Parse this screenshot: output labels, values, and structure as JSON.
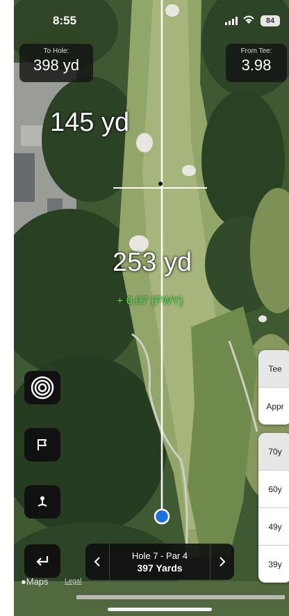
{
  "status": {
    "time": "8:55",
    "battery": "84"
  },
  "to_hole": {
    "label": "To Hole:",
    "value": "398 yd"
  },
  "from_tee": {
    "label": "From Tee:",
    "value": "3.98"
  },
  "distances": {
    "upper": "145 yd",
    "lower": "253 yd",
    "delta": "+ 0.07 (FWY)"
  },
  "buttons": {
    "target": "target-icon",
    "flag": "flag-icon",
    "tee": "golf-tee-icon",
    "back": "return-arrow-icon"
  },
  "club_top": [
    {
      "label": "Tee"
    },
    {
      "label": "Appr"
    }
  ],
  "club_dist": [
    {
      "label": "70y"
    },
    {
      "label": "60y"
    },
    {
      "label": "49y"
    },
    {
      "label": "39y"
    }
  ],
  "hole": {
    "title": "Hole 7 - Par 4",
    "yards": "397 Yards"
  },
  "attribution": {
    "maps": "Maps",
    "legal": "Legal"
  },
  "colors": {
    "blue_marker": "#1e6fe0",
    "delta_green": "#4be34b"
  }
}
